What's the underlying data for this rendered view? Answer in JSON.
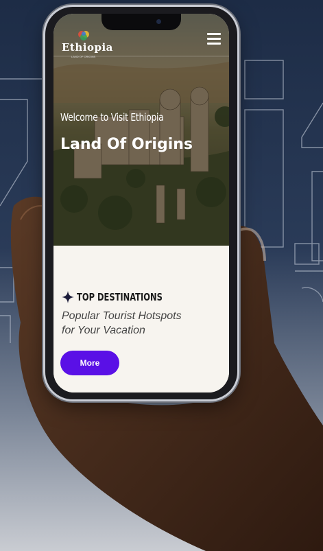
{
  "brand": {
    "name": "Ethiopia",
    "tagline": "LAND OF ORIGINS"
  },
  "hero": {
    "welcome": "Welcome to Visit Ethiopia",
    "title": "Land Of Origins"
  },
  "section": {
    "label": "TOP DESTINATIONS",
    "subtitle_line1": "Popular Tourist Hotspots",
    "subtitle_line2": "for Your Vacation"
  },
  "cta": {
    "more_label": "More"
  },
  "colors": {
    "accent": "#5a10e6",
    "background_top": "#1d2c46",
    "screen_bg": "#f7f4ef"
  },
  "icons": [
    "hamburger-menu-icon",
    "sparkle-star-icon",
    "ethiopia-logo-icon"
  ]
}
